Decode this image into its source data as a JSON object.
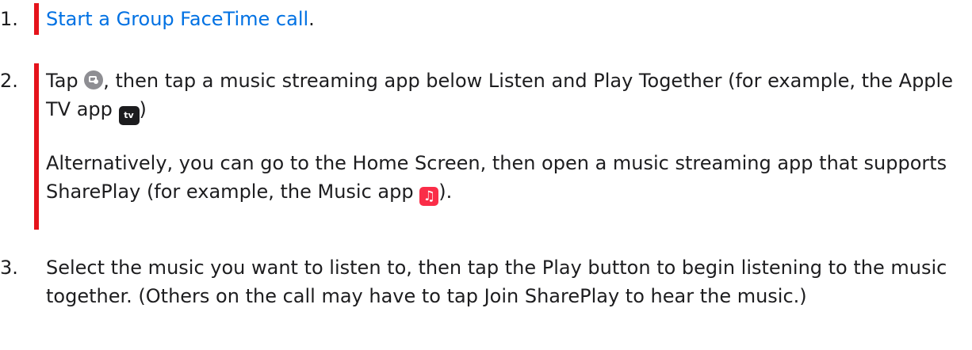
{
  "steps": [
    {
      "number": "1.",
      "link_text": "Start a Group FaceTime call",
      "after_link": "."
    },
    {
      "number": "2.",
      "p1_part1": "Tap ",
      "p1_part2": ", then tap a music streaming app below Listen and Play Together (for example, the Apple TV app ",
      "p1_part3": ")",
      "p2_part1": "Alternatively, you can go to the Home Screen, then open a music streaming app that supports SharePlay (for example, the Music app ",
      "p2_part2": ")."
    },
    {
      "number": "3.",
      "text": "Select the music you want to listen to, then tap the Play button to begin listening to the music together. (Others on the call may have to tap Join SharePlay to hear the music.)"
    }
  ],
  "icons": {
    "shareplay": "shareplay-icon",
    "apple_tv": "apple-tv-app-icon",
    "apple_tv_glyph": "tv",
    "music": "music-app-icon",
    "music_glyph": "♫"
  },
  "colors": {
    "link": "#0071e3",
    "change_bar": "#e5131b",
    "text": "#1d1d1f"
  }
}
